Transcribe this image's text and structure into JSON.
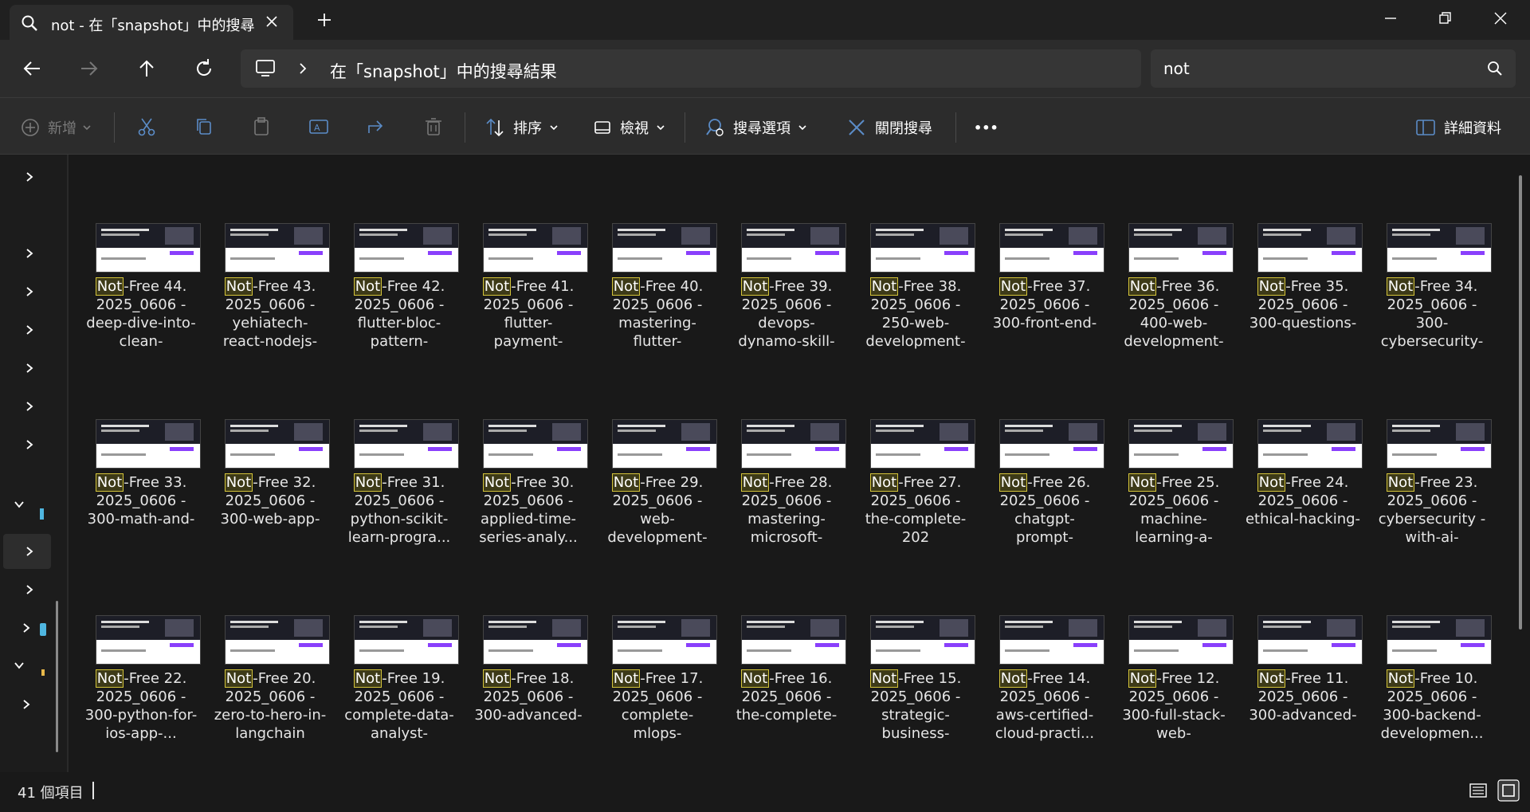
{
  "window": {
    "tab_title": "not - 在「snapshot」中的搜尋",
    "icons": {
      "tab": "search-icon",
      "close": "close-icon",
      "new_tab": "plus-icon"
    }
  },
  "navigation": {
    "breadcrumb": "在「snapshot」中的搜尋結果",
    "search_value": "not"
  },
  "commandbar": {
    "new_label": "新增",
    "sort_label": "排序",
    "view_label": "檢視",
    "search_options_label": "搜尋選項",
    "close_search_label": "關閉搜尋",
    "more_label": "•••",
    "details_label": "詳細資料"
  },
  "files": [
    {
      "highlight": "Not",
      "rest": "-Free 44. 2025_0606 - deep-dive-into-clean-"
    },
    {
      "highlight": "Not",
      "rest": "-Free 43. 2025_0606 - yehiatech-react-nodejs-"
    },
    {
      "highlight": "Not",
      "rest": "-Free 42. 2025_0606 - flutter-bloc-pattern-"
    },
    {
      "highlight": "Not",
      "rest": "-Free 41. 2025_0606 - flutter-payment-"
    },
    {
      "highlight": "Not",
      "rest": "-Free 40. 2025_0606 - mastering-flutter-"
    },
    {
      "highlight": "Not",
      "rest": "-Free 39. 2025_0606 - devops-dynamo-skill-"
    },
    {
      "highlight": "Not",
      "rest": "-Free 38. 2025_0606 - 250-web-development-"
    },
    {
      "highlight": "Not",
      "rest": "-Free 37. 2025_0606 - 300-front-end-"
    },
    {
      "highlight": "Not",
      "rest": "-Free 36. 2025_0606 - 400-web-development-"
    },
    {
      "highlight": "Not",
      "rest": "-Free 35. 2025_0606 - 300-questions-"
    },
    {
      "highlight": "Not",
      "rest": "-Free 34. 2025_0606 - 300-cybersecurity-"
    },
    {
      "highlight": "Not",
      "rest": "-Free 33. 2025_0606 - 300-math-and-"
    },
    {
      "highlight": "Not",
      "rest": "-Free 32. 2025_0606 - 300-web-app-"
    },
    {
      "highlight": "Not",
      "rest": "-Free 31. 2025_0606 - python-scikit-learn-progra..."
    },
    {
      "highlight": "Not",
      "rest": "-Free 30. 2025_0606 - applied-time-series-analy..."
    },
    {
      "highlight": "Not",
      "rest": "-Free 29. 2025_0606 - web-development-"
    },
    {
      "highlight": "Not",
      "rest": "-Free 28. 2025_0606 - mastering-microsoft-"
    },
    {
      "highlight": "Not",
      "rest": "-Free 27. 2025_0606 - the-complete-202"
    },
    {
      "highlight": "Not",
      "rest": "-Free 26. 2025_0606 - chatgpt-prompt-"
    },
    {
      "highlight": "Not",
      "rest": "-Free 25. 2025_0606 - machine-learning-a-"
    },
    {
      "highlight": "Not",
      "rest": "-Free 24. 2025_0606 - ethical-hacking-"
    },
    {
      "highlight": "Not",
      "rest": "-Free 23. 2025_0606 - cybersecurity -with-ai-"
    },
    {
      "highlight": "Not",
      "rest": "-Free 22. 2025_0606 - 300-python-for-ios-app-..."
    },
    {
      "highlight": "Not",
      "rest": "-Free 20. 2025_0606 - zero-to-hero-in-langchain"
    },
    {
      "highlight": "Not",
      "rest": "-Free 19. 2025_0606 - complete-data-analyst-"
    },
    {
      "highlight": "Not",
      "rest": "-Free 18. 2025_0606 - 300-advanced-"
    },
    {
      "highlight": "Not",
      "rest": "-Free 17. 2025_0606 - complete-mlops-"
    },
    {
      "highlight": "Not",
      "rest": "-Free 16. 2025_0606 - the-complete-"
    },
    {
      "highlight": "Not",
      "rest": "-Free 15. 2025_0606 - strategic-business-"
    },
    {
      "highlight": "Not",
      "rest": "-Free 14. 2025_0606 - aws-certified-cloud-practi..."
    },
    {
      "highlight": "Not",
      "rest": "-Free 12. 2025_0606 - 300-full-stack-web-"
    },
    {
      "highlight": "Not",
      "rest": "-Free 11. 2025_0606 - 300-advanced-"
    },
    {
      "highlight": "Not",
      "rest": "-Free 10. 2025_0606 - 300-backend-developmen..."
    }
  ],
  "status": {
    "item_count": "41 個項目"
  },
  "colors": {
    "background": "#191919",
    "chrome": "#2c2c2c",
    "highlight_border": "#d4c43a",
    "accent_purple": "#8a3ffc"
  }
}
